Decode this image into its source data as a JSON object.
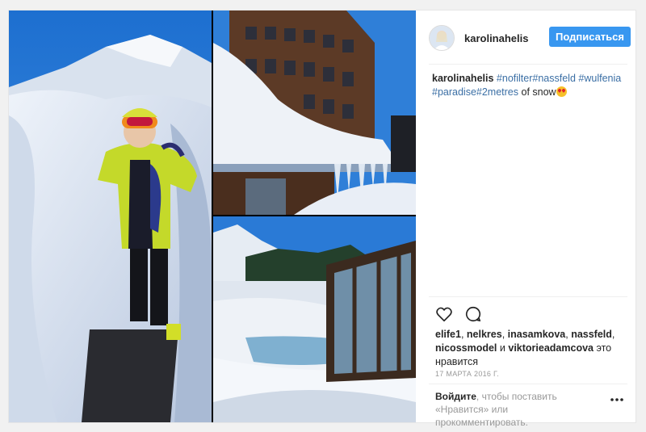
{
  "post": {
    "username": "karolinahelis",
    "follow_label": "Подписаться",
    "caption": {
      "user": "karolinahelis",
      "hashtags": [
        "#nofilter",
        "#nassfeld",
        "#wulfenia",
        "#paradise",
        "#2metres"
      ],
      "text_tail": " of snow"
    },
    "likes": {
      "users": [
        "elife1",
        "nelkres",
        "inasamkova",
        "nassfeld",
        "nicossmodel",
        "viktorieadamcova"
      ],
      "and_word": "и",
      "suffix": "это нравится"
    },
    "date": "17 МАРТА 2016 Г.",
    "comment_prompt": {
      "login_link": "Войдите",
      "text": ", чтобы поставить «Нравится» или прокомментировать."
    }
  },
  "icons": {
    "like": "heart-icon",
    "comment": "comment-bubble-icon",
    "more": "more-dots-icon"
  },
  "colors": {
    "follow_button": "#3897f0",
    "hashtag": "#3b6fa5",
    "background": "#f1f1f1"
  }
}
